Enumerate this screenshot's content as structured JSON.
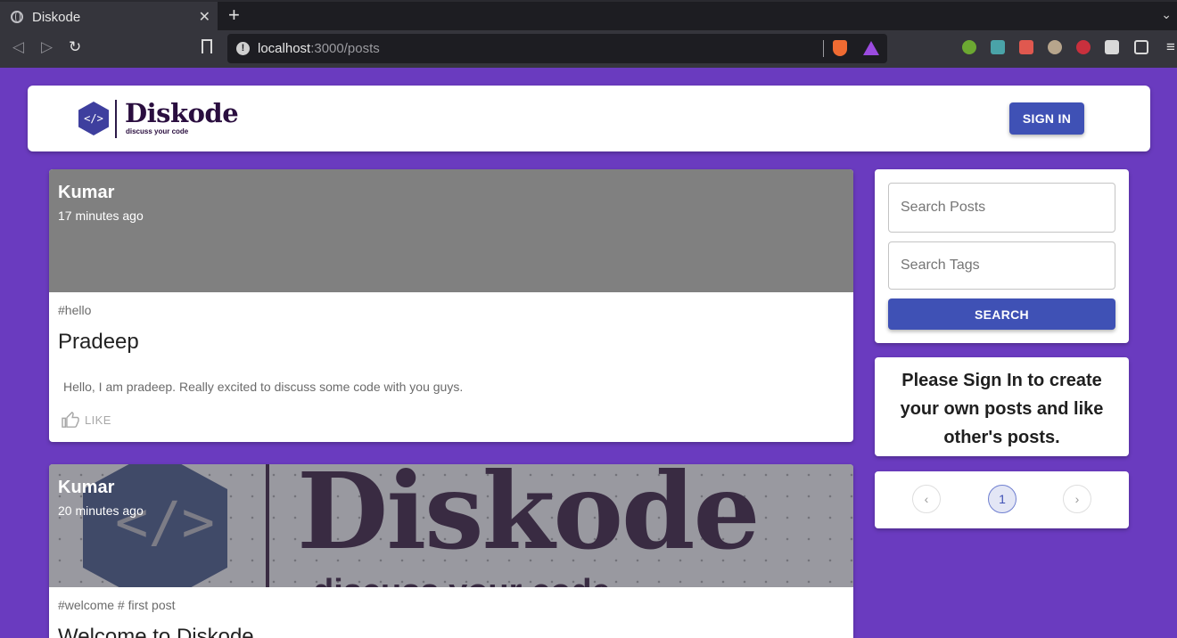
{
  "browser": {
    "tab_title": "Diskode",
    "close_glyph": "✕",
    "new_tab_glyph": "+",
    "menu_glyph": "⌄",
    "url_host": "localhost",
    "url_rest": ":3000/posts"
  },
  "header": {
    "logo_word": "Diskode",
    "logo_tagline": "discuss your code",
    "logo_glyph": "</>",
    "signin_label": "SIGN IN"
  },
  "posts": [
    {
      "author": "Kumar",
      "time": "17 minutes ago",
      "tags": "#hello",
      "title": "Pradeep",
      "message": "Hello, I am pradeep. Really excited to discuss some code with you guys.",
      "like_label": "LIKE"
    },
    {
      "author": "Kumar",
      "time": "20 minutes ago",
      "tags": "#welcome # first post",
      "title": "Welcome to Diskode",
      "image_word": "Diskode",
      "image_tagline": "discuss your code",
      "image_glyph": "</>"
    }
  ],
  "sidebar": {
    "search_posts_placeholder": "Search Posts",
    "search_tags_placeholder": "Search Tags",
    "search_label": "SEARCH",
    "signin_prompt": "Please Sign In to create your own posts and like other's posts.",
    "pagination": {
      "prev": "‹",
      "current": "1",
      "next": "›"
    }
  },
  "colors": {
    "page_bg": "#6a3bbf",
    "primary": "#3f51b5",
    "brand_dark": "#2a0e3f"
  }
}
